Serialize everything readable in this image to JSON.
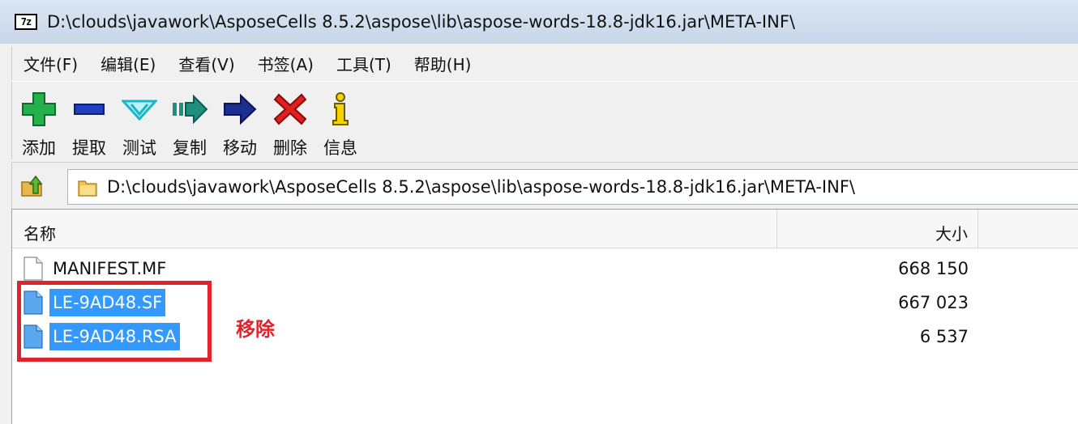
{
  "window": {
    "icon_text": "7z",
    "title": "D:\\clouds\\javawork\\AsposeCells 8.5.2\\aspose\\lib\\aspose-words-18.8-jdk16.jar\\META-INF\\"
  },
  "menu": {
    "items": [
      "文件(F)",
      "编辑(E)",
      "查看(V)",
      "书签(A)",
      "工具(T)",
      "帮助(H)"
    ]
  },
  "toolbar": {
    "buttons": [
      {
        "label": "添加",
        "icon": "add-icon",
        "color": "#22b14c"
      },
      {
        "label": "提取",
        "icon": "extract-icon",
        "color": "#1f3fbf"
      },
      {
        "label": "测试",
        "icon": "test-icon",
        "color": "#19b6c9"
      },
      {
        "label": "复制",
        "icon": "copy-icon",
        "color": "#1f8f7f"
      },
      {
        "label": "移动",
        "icon": "move-icon",
        "color": "#1a2f8f"
      },
      {
        "label": "删除",
        "icon": "delete-icon",
        "color": "#e02020"
      },
      {
        "label": "信息",
        "icon": "info-icon",
        "color": "#e0c000"
      }
    ]
  },
  "address": {
    "path": "D:\\clouds\\javawork\\AsposeCells 8.5.2\\aspose\\lib\\aspose-words-18.8-jdk16.jar\\META-INF\\",
    "up_icon": "up-folder-icon",
    "folder_icon": "folder-icon"
  },
  "filelist": {
    "headers": {
      "name": "名称",
      "size": "大小"
    },
    "rows": [
      {
        "name": "MANIFEST.MF",
        "size": "668 150",
        "selected": false
      },
      {
        "name": "LE-9AD48.SF",
        "size": "667 023",
        "selected": true
      },
      {
        "name": "LE-9AD48.RSA",
        "size": "6 537",
        "selected": true
      }
    ],
    "selection_color": "#3399ff"
  },
  "annotation": {
    "text": "移除",
    "color": "#e0242e"
  }
}
